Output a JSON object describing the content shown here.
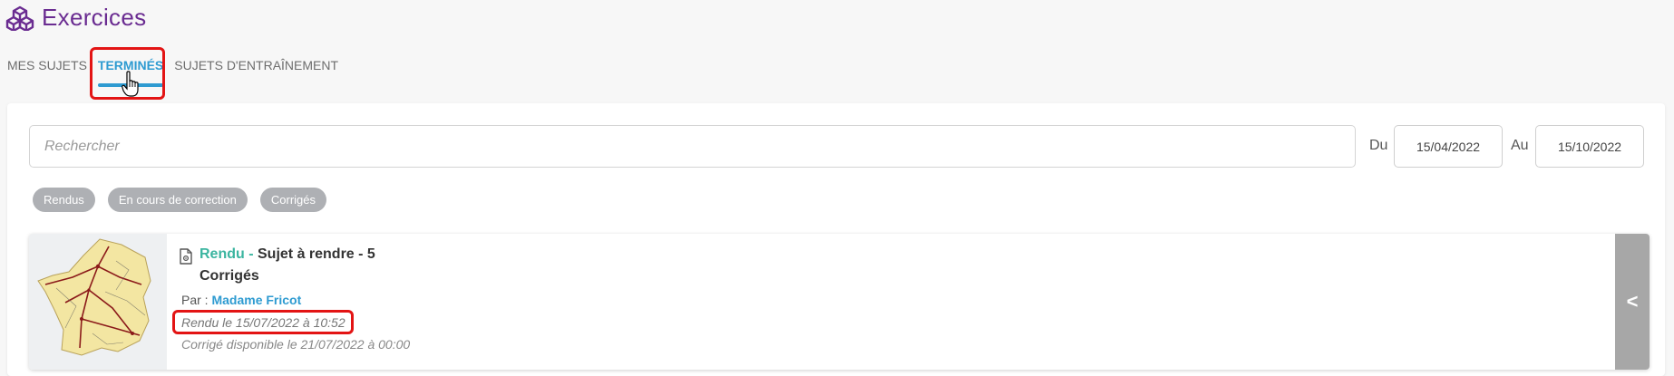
{
  "header": {
    "icon": "cubes-icon",
    "title": "Exercices",
    "title_color": "#6a2c91"
  },
  "tabs": [
    {
      "label": "MES SUJETS",
      "active": false
    },
    {
      "label": "TERMINÉS",
      "active": true
    },
    {
      "label": "SUJETS D'ENTRAÎNEMENT",
      "active": false
    }
  ],
  "accent_color": "#2e9bd1",
  "search": {
    "placeholder": "Rechercher",
    "value": ""
  },
  "date_range": {
    "from_label": "Du",
    "from_value": "15/04/2022",
    "to_label": "Au",
    "to_value": "15/10/2022"
  },
  "filters": [
    "Rendus",
    "En cours de correction",
    "Corrigés"
  ],
  "card": {
    "thumbnail": "france-railway-map",
    "icon": "document-settings-icon",
    "status": "Rendu -",
    "status_color": "#3bb5a0",
    "subject": "Sujet à rendre - 5",
    "category": "Corrigés",
    "author_prefix": "Par :",
    "author": "Madame Fricot",
    "submitted": "Rendu le 15/07/2022 à 10:52",
    "correction": "Corrigé disponible le 21/07/2022 à 00:00",
    "expand_symbol": "<"
  },
  "highlight_color": "#e31414"
}
